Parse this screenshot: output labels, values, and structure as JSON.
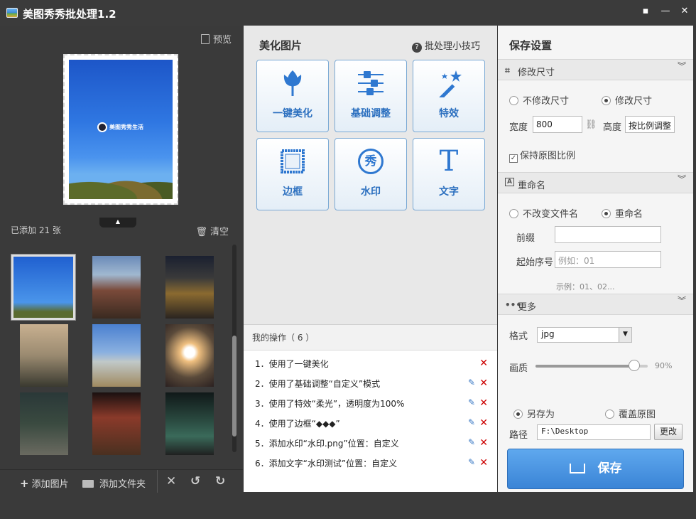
{
  "window": {
    "title": "美图秀秀批处理1.2"
  },
  "left": {
    "preview_label": "预览",
    "added_count": "已添加 21 张",
    "clear_label": "清空",
    "add_image": "添加图片",
    "add_folder": "添加文件夹",
    "preview_watermark": "美图秀秀生活"
  },
  "middle": {
    "header": "美化图片",
    "tips": "批处理小技巧",
    "cards": [
      {
        "label": "一键美化",
        "icon": "tulip-icon"
      },
      {
        "label": "基础调整",
        "icon": "sliders-icon"
      },
      {
        "label": "特效",
        "icon": "magic-wand-icon"
      },
      {
        "label": "边框",
        "icon": "frame-icon"
      },
      {
        "label": "水印",
        "icon": "watermark-icon"
      },
      {
        "label": "文字",
        "icon": "text-icon"
      }
    ],
    "watermark_glyph": "秀",
    "text_glyph": "T",
    "ops_header": "我的操作（ 6 ）",
    "ops": [
      "1．使用了一键美化",
      "2．使用了基础调整“自定义”模式",
      "3．使用了特效“柔光”，透明度为100%",
      "4．使用了边框“◆◆◆”",
      "5．添加水印“水印.png”位置：自定义",
      "6．添加文字“水印测试”位置：自定义"
    ]
  },
  "right": {
    "header": "保存设置",
    "resize_section": "修改尺寸",
    "no_resize": "不修改尺寸",
    "resize": "修改尺寸",
    "width_label": "宽度",
    "width_value": "800",
    "height_label": "高度",
    "height_value": "按比例调整",
    "keep_ratio": "保持原图比例",
    "rename_section": "重命名",
    "no_rename": "不改变文件名",
    "rename": "重命名",
    "prefix_label": "前缀",
    "start_label": "起始序号",
    "start_placeholder": "例如：01",
    "example": "示例：01、02...",
    "more_section": "更多",
    "format_label": "格式",
    "format_value": "jpg",
    "quality_label": "画质",
    "quality_value": "90%",
    "quality_fraction": 0.88,
    "save_as": "另存为",
    "overwrite": "覆盖原图",
    "path_label": "路径",
    "path_value": "F:\\Desktop",
    "change_btn": "更改",
    "save_btn": "保存"
  },
  "colors": {
    "accent": "#3a84d6",
    "card_label": "#2b6fbf",
    "delete": "#cc0000"
  }
}
